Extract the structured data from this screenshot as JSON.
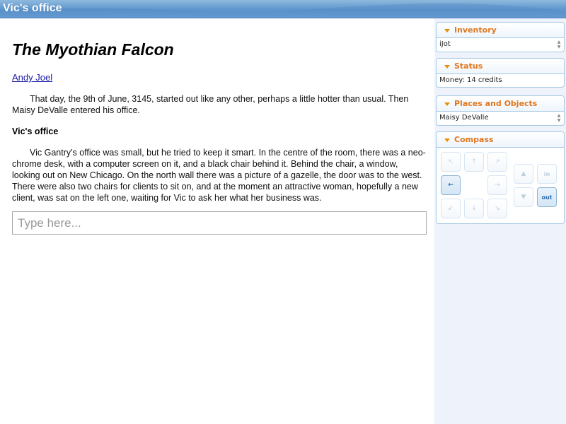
{
  "window": {
    "title": "Vic's office"
  },
  "story": {
    "title": "The Myothian Falcon",
    "author": "Andy Joel",
    "intro": "That day, the 9th of June, 3145, started out like any other, perhaps a little hotter than usual. Then Maisy DeValle entered his office.",
    "room_heading": "Vic's office",
    "room_description": "Vic Gantry's office was small, but he tried to keep it smart. In the centre of the room, there was a neo-chrome desk, with a computer screen on it, and a black chair behind it. Behind the chair, a window, looking out on New Chicago. On the north wall there was a picture of a gazelle, the door was to the west. There were also two chairs for clients to sit on, and at the moment an attractive woman, hopefully a new client, was sat on the left one, waiting for Vic to ask her what her business was."
  },
  "command": {
    "placeholder": "Type here..."
  },
  "sidebar": {
    "inventory": {
      "label": "Inventory",
      "items": [
        "iJot"
      ]
    },
    "status": {
      "label": "Status",
      "text": "Money: 14 credits"
    },
    "places": {
      "label": "Places and Objects",
      "items": [
        "Maisy DeValle"
      ]
    },
    "compass": {
      "label": "Compass",
      "buttons": {
        "nw": "↖",
        "n": "↑",
        "ne": "↗",
        "w": "←",
        "e": "→",
        "sw": "↙",
        "s": "↓",
        "se": "↘",
        "up": "▲",
        "down": "▼",
        "in": "in",
        "out": "out"
      },
      "enabled": [
        "w",
        "out"
      ]
    }
  },
  "colors": {
    "accent": "#e1771e",
    "titlebar": "#5d95cc",
    "panel_border": "#a6c9e2"
  }
}
